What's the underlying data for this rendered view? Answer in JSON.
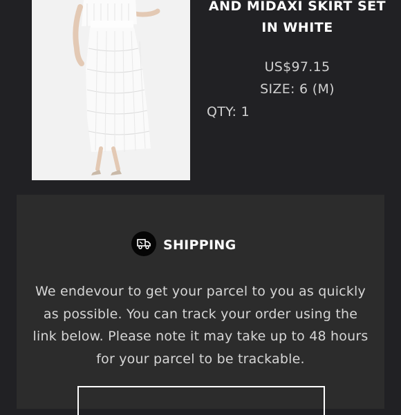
{
  "product": {
    "title_line1": "AND MIDAXI SKIRT SET",
    "title_line2": "IN WHITE",
    "price": "US$97.15",
    "size": "SIZE: 6 (M)",
    "qty": "QTY: 1"
  },
  "shipping": {
    "heading": "SHIPPING",
    "icon": "delivery-truck-icon",
    "body": "We endevour to get your parcel to you as quickly as possible. You can track your order using the link below. Please note it may take up to 48 hours for your parcel to be trackable."
  },
  "colors": {
    "page_background": "#212124",
    "panel_background": "#2c2c2c",
    "heading_text": "#ffffff",
    "body_text": "#d6d6d6"
  }
}
